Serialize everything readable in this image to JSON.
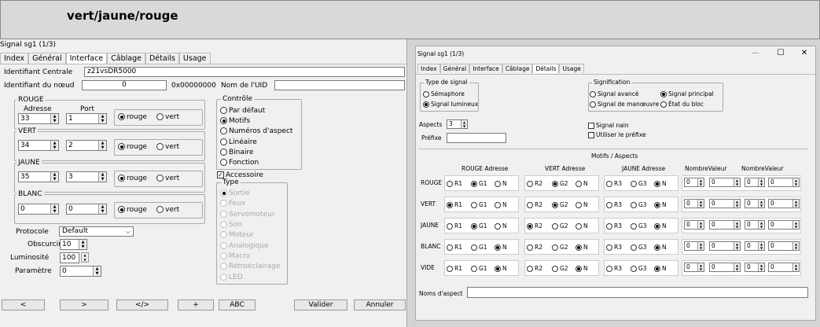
{
  "header": {
    "title": "vert/jaune/rouge"
  },
  "left_window": {
    "title": "Signal sg1 (1/3)",
    "tabs": [
      "Index",
      "Général",
      "Interface",
      "Câblage",
      "Détails",
      "Usage"
    ],
    "identifiant_centrale_label": "Identifiant Centrale",
    "identifiant_centrale_value": "z21vsDR5000",
    "identifiant_noeud_label": "Identifiant du nœud",
    "identifiant_noeud_value": "0",
    "hex_value": "0x00000000",
    "nom_uid_label": "Nom de l'UID",
    "rouge": {
      "label": "ROUGE",
      "adresse_label": "Adresse",
      "port_label": "Port",
      "adresse": "33",
      "port": "1"
    },
    "vert": {
      "label": "VERT",
      "adresse": "34",
      "port": "2"
    },
    "jaune": {
      "label": "JAUNE",
      "adresse": "35",
      "port": "3"
    },
    "blanc": {
      "label": "BLANC",
      "adresse": "0",
      "port": "0"
    },
    "radio_rouge": "rouge",
    "radio_vert": "vert",
    "controle": {
      "label": "Contrôle",
      "options": [
        "Par défaut",
        "Motifs",
        "Numéros d'aspect",
        "Linéaire",
        "Binaire",
        "Fonction"
      ],
      "selected": "Motifs"
    },
    "accessoire_label": "Accessoire",
    "type": {
      "label": "Type",
      "options": [
        "Sortie",
        "Feux",
        "Servomoteur",
        "Son",
        "Moteur",
        "Analogique",
        "Macro",
        "Rétroéclairage",
        "LED"
      ],
      "selected": "Sortie"
    },
    "protocole_label": "Protocole",
    "protocole_value": "Default",
    "obscurcir_label": "Obscurcir",
    "obscurcir_value": "10",
    "luminosite_label": "Luminosité",
    "luminosite_value": "100",
    "parametre_label": "Paramètre",
    "parametre_value": "0",
    "buttons": [
      "<",
      ">",
      "</>",
      "+",
      "ABC",
      "Valider",
      "Annuler"
    ]
  },
  "right_window": {
    "title": "Signal sg1 (1/3)",
    "controls": {
      "minimize": "—",
      "maximize": "☐",
      "close": "✕"
    },
    "tabs": [
      "Index",
      "Général",
      "Interface",
      "Câblage",
      "Détails",
      "Usage"
    ],
    "type_signal": {
      "label": "Type de signal",
      "options": [
        "Sémaphore",
        "Signal lumineux"
      ],
      "selected": "Signal lumineux"
    },
    "signification": {
      "label": "Signification",
      "options": [
        "Signal avancé",
        "Signal principal",
        "Signal de manœuvre",
        "État du bloc"
      ],
      "selected": "Signal principal"
    },
    "aspects_label": "Aspects",
    "aspects_value": "3",
    "prefixe_label": "Préfixe",
    "signal_nain_label": "Signal nain",
    "utiliser_prefixe_label": "Utiliser le préfixe",
    "motifs_title": "Motifs / Aspects",
    "col_headers": [
      "ROUGE Adresse",
      "VERT Adresse",
      "JAUNE Adresse",
      "NombreValeur",
      "NombreValeur"
    ],
    "rows": [
      {
        "name": "ROUGE",
        "rouge": [
          "R1",
          "G1",
          "N"
        ],
        "rouge_sel": 1,
        "vert": [
          "R2",
          "G2",
          "N"
        ],
        "vert_sel": 1,
        "jaune": [
          "R3",
          "G3",
          "N"
        ],
        "jaune_sel": 2,
        "values": [
          "0",
          "0",
          "0",
          "0"
        ]
      },
      {
        "name": "VERT",
        "rouge": [
          "R1",
          "G1",
          "N"
        ],
        "rouge_sel": 0,
        "vert": [
          "R2",
          "G2",
          "N"
        ],
        "vert_sel": 1,
        "jaune": [
          "R3",
          "G3",
          "N"
        ],
        "jaune_sel": 2,
        "values": [
          "0",
          "0",
          "0",
          "0"
        ]
      },
      {
        "name": "JAUNE",
        "rouge": [
          "R1",
          "G1",
          "N"
        ],
        "rouge_sel": 1,
        "vert": [
          "R2",
          "G2",
          "N"
        ],
        "vert_sel": 0,
        "jaune": [
          "R3",
          "G3",
          "N"
        ],
        "jaune_sel": 2,
        "values": [
          "0",
          "0",
          "0",
          "0"
        ]
      },
      {
        "name": "BLANC",
        "rouge": [
          "R1",
          "G1",
          "N"
        ],
        "rouge_sel": 2,
        "vert": [
          "R2",
          "G2",
          "N"
        ],
        "vert_sel": 2,
        "jaune": [
          "R3",
          "G3",
          "N"
        ],
        "jaune_sel": 2,
        "values": [
          "0",
          "0",
          "0",
          "0"
        ]
      },
      {
        "name": "VIDE",
        "rouge": [
          "R1",
          "G1",
          "N"
        ],
        "rouge_sel": 2,
        "vert": [
          "R2",
          "G2",
          "N"
        ],
        "vert_sel": 2,
        "jaune": [
          "R3",
          "G3",
          "N"
        ],
        "jaune_sel": 2,
        "values": [
          "0",
          "0",
          "0",
          "0"
        ]
      }
    ],
    "noms_aspect_label": "Noms d'aspect"
  }
}
